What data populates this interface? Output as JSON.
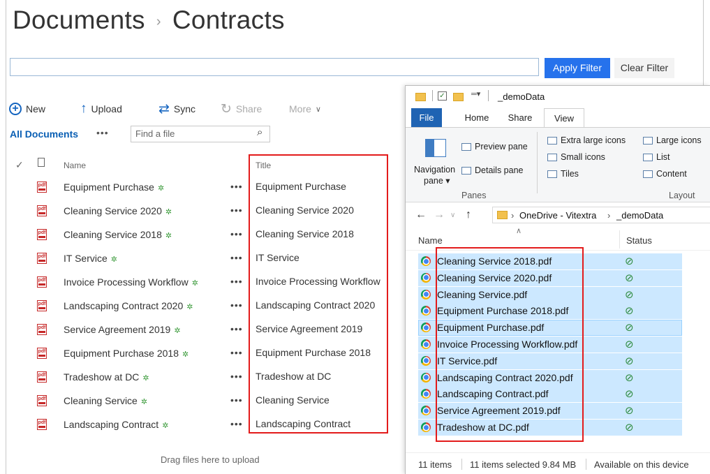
{
  "breadcrumb": {
    "parent": "Documents",
    "separator": "›",
    "current": "Contracts"
  },
  "filter": {
    "apply_label": "Apply Filter",
    "clear_label": "Clear Filter",
    "value": ""
  },
  "commands": {
    "new_label": "New",
    "upload_label": "Upload",
    "sync_label": "Sync",
    "share_label": "Share",
    "more_label": "More"
  },
  "views": {
    "current": "All Documents",
    "more_glyph": "•••",
    "find_placeholder": "Find a file"
  },
  "columns": {
    "name": "Name",
    "title": "Title"
  },
  "documents": [
    {
      "name": "Equipment Purchase",
      "title": "Equipment Purchase"
    },
    {
      "name": "Cleaning Service 2020",
      "title": "Cleaning Service 2020"
    },
    {
      "name": "Cleaning Service 2018",
      "title": "Cleaning Service 2018"
    },
    {
      "name": "IT Service",
      "title": "IT Service"
    },
    {
      "name": "Invoice Processing Workflow",
      "title": "Invoice Processing Workflow"
    },
    {
      "name": "Landscaping Contract 2020",
      "title": "Landscaping Contract 2020"
    },
    {
      "name": "Service Agreement 2019",
      "title": "Service Agreement 2019"
    },
    {
      "name": "Equipment Purchase 2018",
      "title": "Equipment Purchase 2018"
    },
    {
      "name": "Tradeshow at DC",
      "title": "Tradeshow at DC"
    },
    {
      "name": "Cleaning Service",
      "title": "Cleaning Service"
    },
    {
      "name": "Landscaping Contract",
      "title": "Landscaping Contract"
    }
  ],
  "new_badge_glyph": "✲",
  "row_menu_glyph": "•••",
  "drop_hint": "Drag files here to upload",
  "explorer": {
    "window_title": "_demoData",
    "tabs": [
      "File",
      "Home",
      "Share",
      "View"
    ],
    "ribbon": {
      "navigation_pane_line1": "Navigation",
      "navigation_pane_line2": "pane ▾",
      "preview_pane": "Preview pane",
      "details_pane": "Details pane",
      "panes_group": "Panes",
      "extra_large_icons": "Extra large icons",
      "large_icons": "Large icons",
      "small_icons": "Small icons",
      "list": "List",
      "tiles": "Tiles",
      "content": "Content",
      "layout_group": "Layout"
    },
    "address": {
      "root": "OneDrive - Vitextra",
      "sep": "›",
      "folder": "_demoData"
    },
    "columns": {
      "name": "Name",
      "status": "Status"
    },
    "files": [
      "Cleaning Service 2018.pdf",
      "Cleaning Service 2020.pdf",
      "Cleaning Service.pdf",
      "Equipment Purchase 2018.pdf",
      "Equipment Purchase.pdf",
      "Invoice Processing Workflow.pdf",
      "IT Service.pdf",
      "Landscaping Contract 2020.pdf",
      "Landscaping Contract.pdf",
      "Service Agreement 2019.pdf",
      "Tradeshow at DC.pdf"
    ],
    "status_glyph": "⊘",
    "statusbar": {
      "items": "11 items",
      "selected": "11 items selected  9.84 MB",
      "availability": "Available on this device"
    }
  },
  "colors": {
    "accent": "#2672ec",
    "highlight_box": "#e31b1b",
    "selection": "#cce8ff",
    "file_tab": "#1f63b3"
  }
}
